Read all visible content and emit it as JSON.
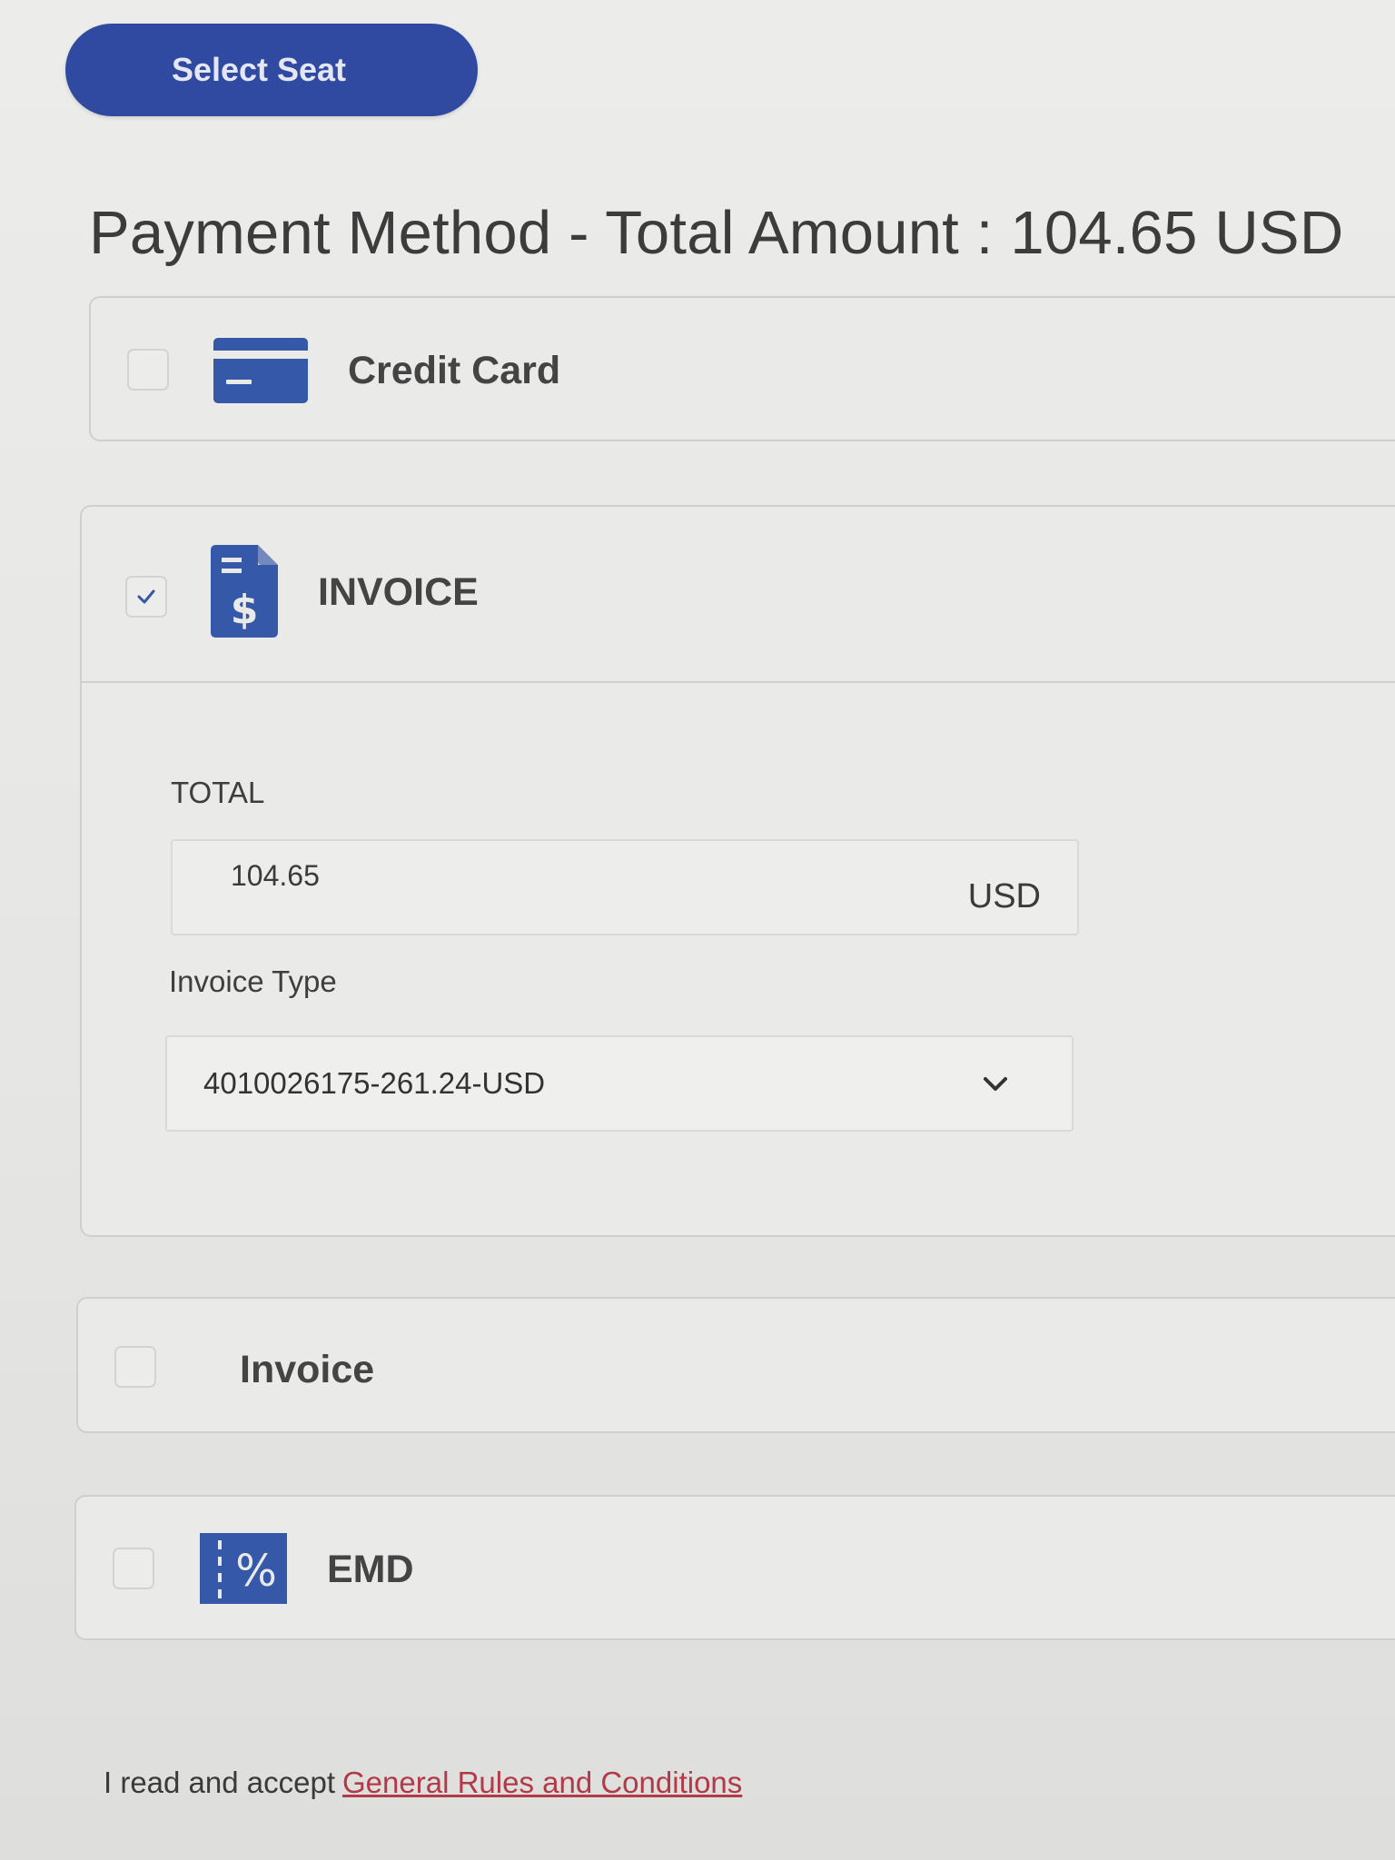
{
  "actions": {
    "select_seat_label": "Select Seat"
  },
  "payment": {
    "title": "Payment Method - Total Amount : 104.65 USD",
    "options": [
      {
        "label": "Credit Card",
        "checked": false,
        "icon": "credit-card-icon"
      },
      {
        "label": "INVOICE",
        "checked": true,
        "icon": "invoice-dollar-icon"
      },
      {
        "label": "Invoice",
        "checked": false,
        "icon": ""
      },
      {
        "label": "EMD",
        "checked": false,
        "icon": "percent-ticket-icon"
      }
    ],
    "invoice_form": {
      "total_label": "TOTAL",
      "total_value": "104.65",
      "total_currency": "USD",
      "type_label": "Invoice Type",
      "type_selected": "4010026175-261.24-USD"
    }
  },
  "terms": {
    "prefix": "I read and accept",
    "link_label": "General Rules and Conditions"
  },
  "colors": {
    "primary": "#2f4aa0",
    "icon_blue": "#3558a8",
    "link": "#b23a48"
  }
}
